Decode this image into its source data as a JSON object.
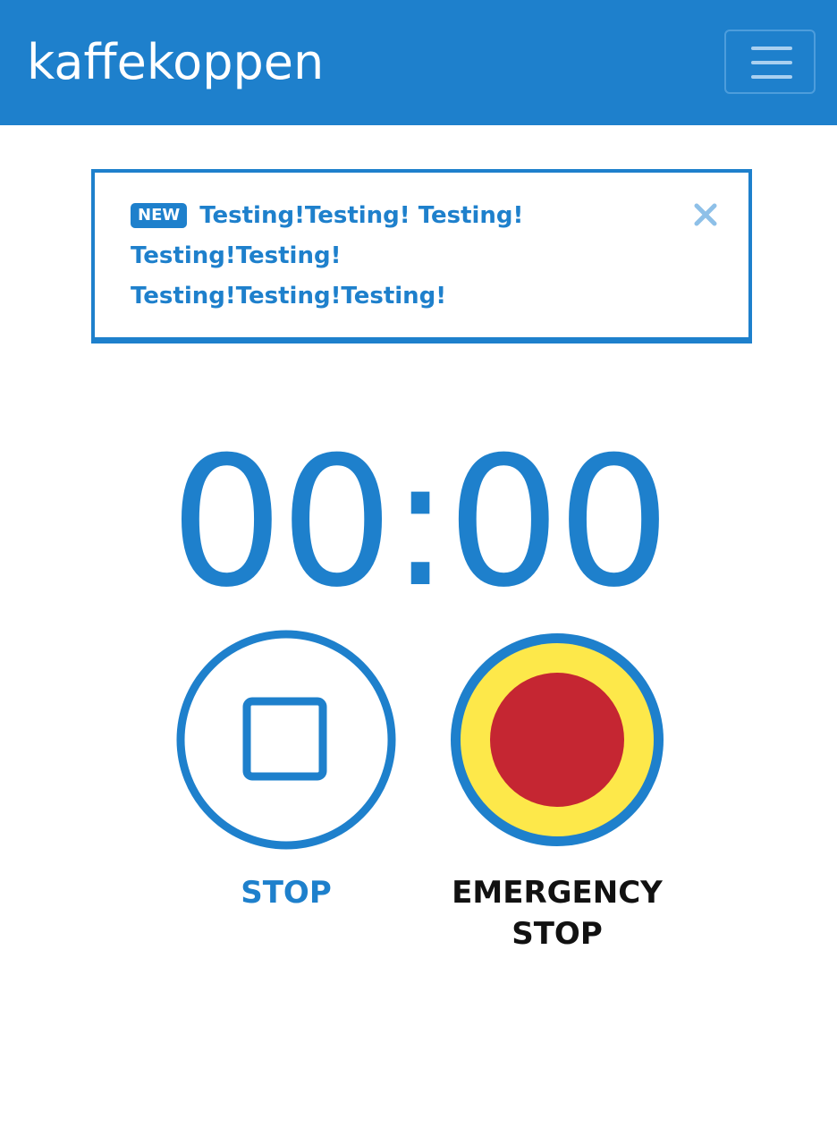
{
  "navbar": {
    "brand": "kaffekoppen",
    "menu_icon": "hamburger-menu-icon"
  },
  "alert": {
    "badge": "NEW",
    "message_line1": "Testing!Testing! Testing!",
    "message_line2": "Testing!Testing!",
    "message_line3": "Testing!Testing!Testing!",
    "close_icon": "close-icon"
  },
  "timer": {
    "display": "00:00"
  },
  "controls": {
    "stop_label": "STOP",
    "stop_icon": "stop-square-icon",
    "emergency_label_line1": "EMERGENCY",
    "emergency_label_line2": "STOP",
    "emergency_icon": "emergency-stop-icon"
  },
  "colors": {
    "primary": "#1e80cc",
    "emergency_ring": "#fde84a",
    "emergency_core": "#c52632"
  }
}
